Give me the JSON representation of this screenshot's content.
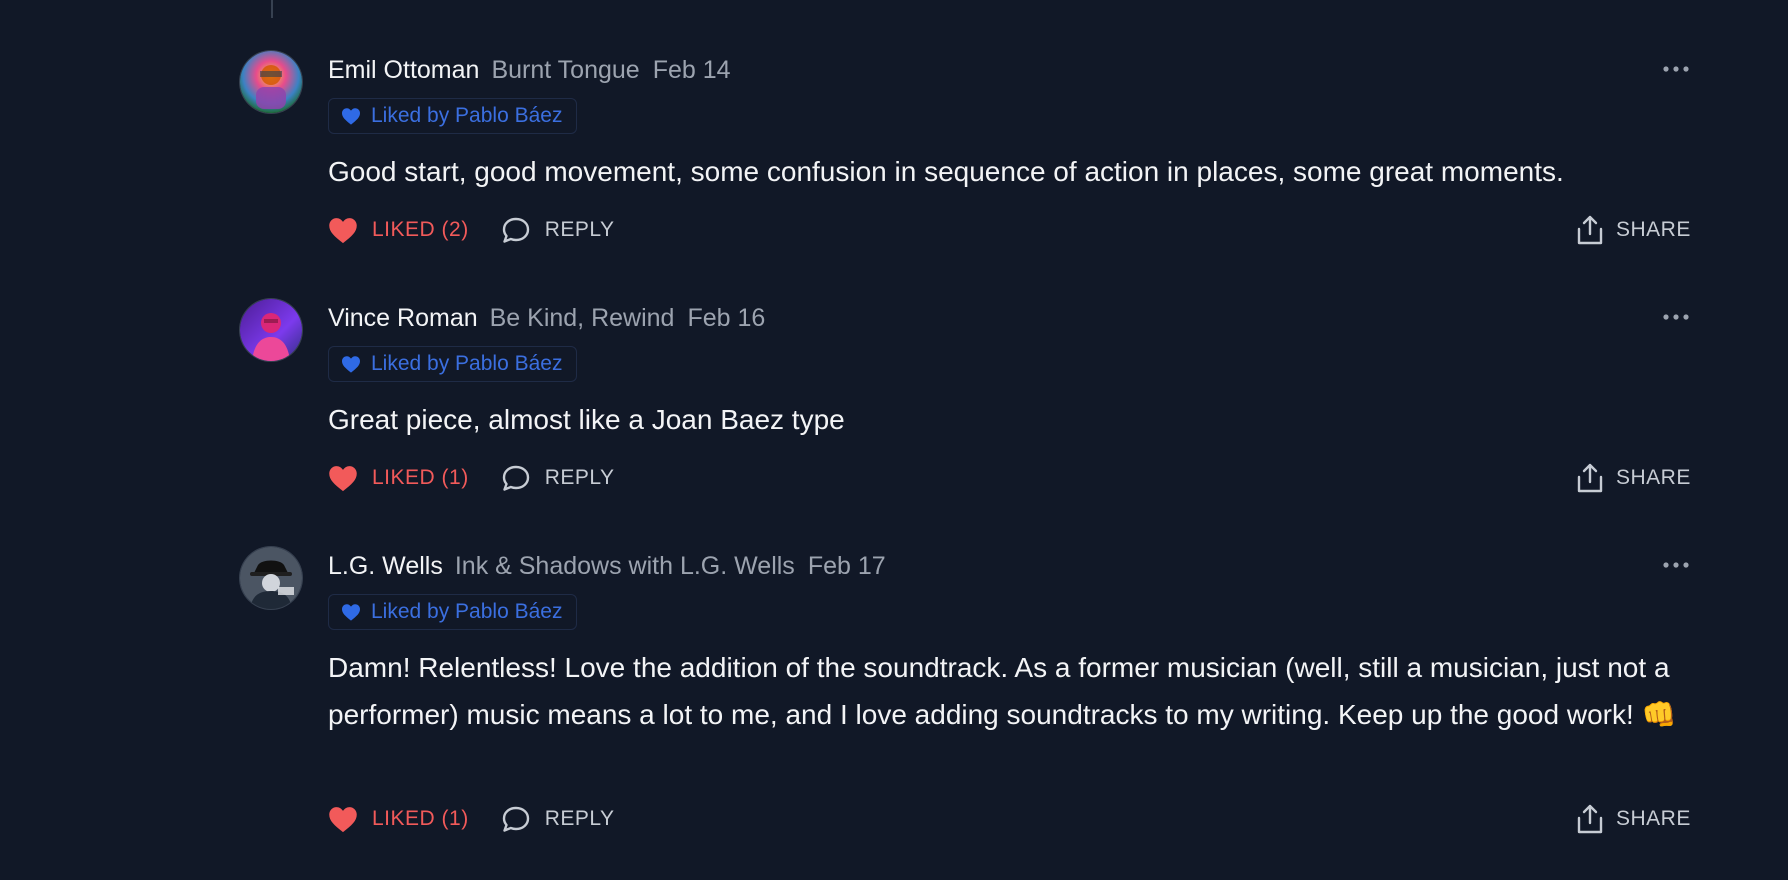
{
  "comments": [
    {
      "author": "Emil Ottoman",
      "publication": "Burnt Tongue",
      "date": "Feb 14",
      "liked_by": "Liked by Pablo Báez",
      "text": "Good start, good movement, some confusion in sequence of action in places, some great moments.",
      "like_label": "LIKED (2)",
      "reply_label": "REPLY",
      "share_label": "SHARE"
    },
    {
      "author": "Vince Roman",
      "publication": "Be Kind, Rewind",
      "date": "Feb 16",
      "liked_by": "Liked by Pablo Báez",
      "text": "Great piece, almost like a Joan Baez type",
      "like_label": "LIKED (1)",
      "reply_label": "REPLY",
      "share_label": "SHARE"
    },
    {
      "author": "L.G. Wells",
      "publication": "Ink & Shadows with L.G. Wells",
      "date": "Feb 17",
      "liked_by": "Liked by Pablo Báez",
      "text": "Damn! Relentless! Love the addition of the soundtrack. As a former musician (well, still a musician, just not a performer) music means a lot to me, and I love adding soundtracks to my writing. Keep up the good work! 👊",
      "like_label": "LIKED (1)",
      "reply_label": "REPLY",
      "share_label": "SHARE"
    }
  ],
  "colors": {
    "background": "#111827",
    "liked_red": "#f25a5a",
    "badge_blue": "#3b6fe0",
    "muted": "#9ca3af"
  },
  "icons": {
    "like": "heart-icon",
    "reply": "speech-bubble-icon",
    "share": "share-upload-icon",
    "more": "ellipsis-icon",
    "badge": "heart-icon"
  }
}
